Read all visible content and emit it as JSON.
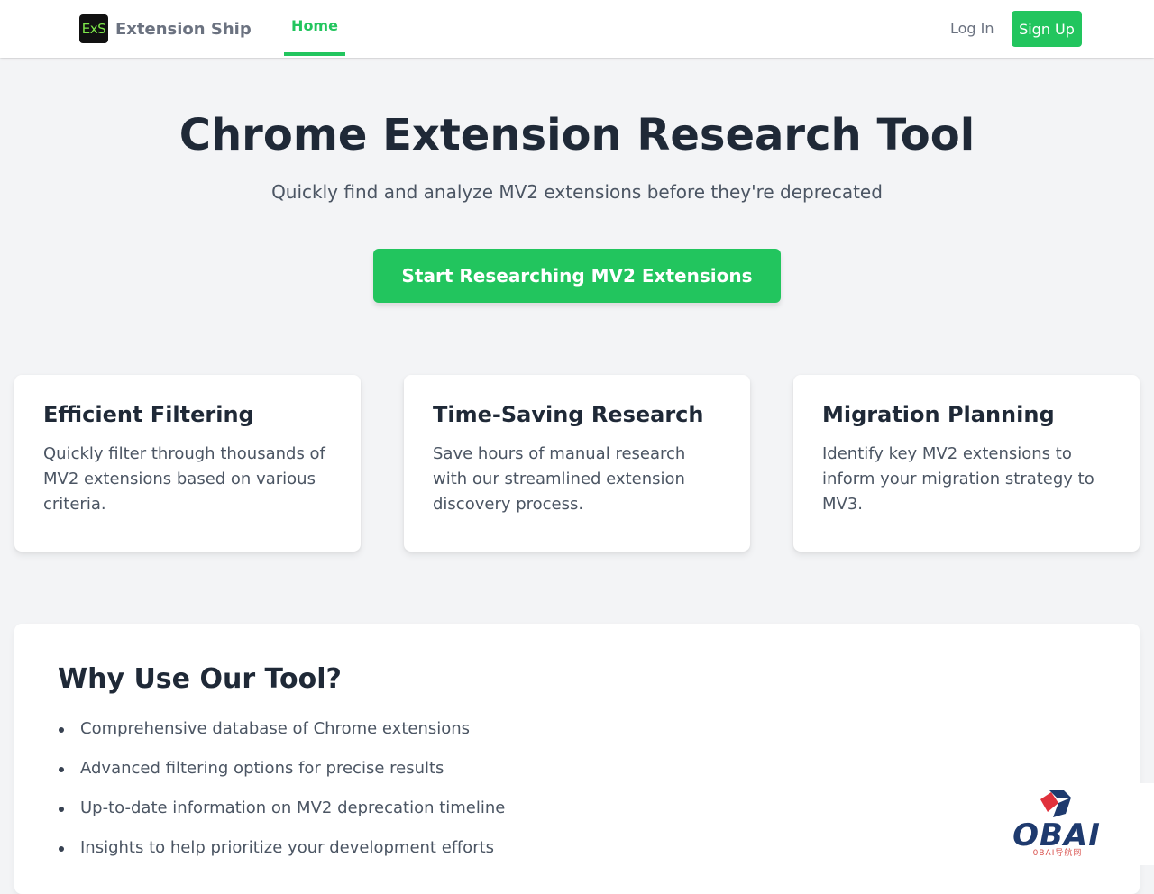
{
  "header": {
    "logo_text": "ExS",
    "brand": "Extension Ship",
    "nav_home": "Home",
    "login": "Log In",
    "signup": "Sign Up"
  },
  "hero": {
    "title": "Chrome Extension Research Tool",
    "subtitle": "Quickly find and analyze MV2 extensions before they're deprecated",
    "cta": "Start Researching MV2 Extensions"
  },
  "features": [
    {
      "title": "Efficient Filtering",
      "text": "Quickly filter through thousands of MV2 extensions based on various criteria."
    },
    {
      "title": "Time-Saving Research",
      "text": "Save hours of manual research with our streamlined extension discovery process."
    },
    {
      "title": "Migration Planning",
      "text": "Identify key MV2 extensions to inform your migration strategy to MV3."
    }
  ],
  "why": {
    "title": "Why Use Our Tool?",
    "items": [
      "Comprehensive database of Chrome extensions",
      "Advanced filtering options for precise results",
      "Up-to-date information on MV2 deprecation timeline",
      "Insights to help prioritize your development efforts"
    ]
  },
  "watermark": {
    "text": "OBAI",
    "small": "0BAI导航网"
  },
  "colors": {
    "accent": "#22c55e",
    "background": "#f3f4f6",
    "heading": "#1f2937",
    "body_text": "#4b5563"
  }
}
